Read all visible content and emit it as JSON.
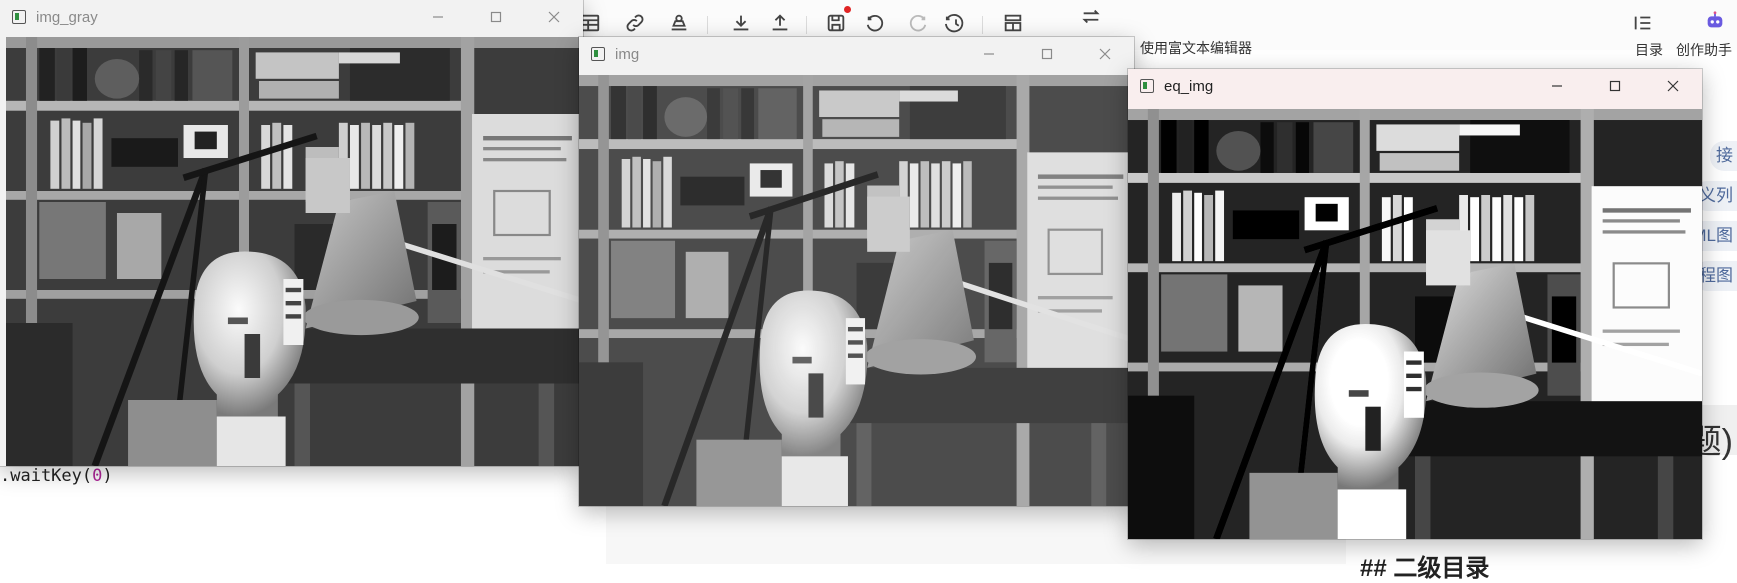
{
  "editor": {
    "toolbar": {
      "rich_text_label": "使用富文本编辑器",
      "toc_label": "目录",
      "assistant_label": "创作助手",
      "icons": [
        "video-icon",
        "table-icon",
        "link-icon",
        "stamp-icon",
        "download-icon",
        "upload-icon",
        "save-icon",
        "undo-icon",
        "redo-icon",
        "history-icon",
        "layout-icon",
        "switch-icon",
        "toc-icon",
        "assistant-robot-icon"
      ]
    },
    "side_links": [
      "接",
      "义列",
      "ML图",
      "程图"
    ],
    "title_peek": "题)",
    "heading_peek": "## 二级目录",
    "code_line": {
      "prefix": ".waitKey(",
      "arg": "0",
      "suffix": ")"
    }
  },
  "windows": [
    {
      "id": "img_gray",
      "title": "img_gray",
      "state": "inactive"
    },
    {
      "id": "img",
      "title": "img",
      "state": "inactive"
    },
    {
      "id": "eq_img",
      "title": "eq_img",
      "state": "active"
    }
  ],
  "colors": {
    "active_titlebar": "#f9eeee",
    "inactive_titlebar": "#f2f2f2",
    "accent_link": "#4f6a9c",
    "save_dot": "#e02424"
  }
}
